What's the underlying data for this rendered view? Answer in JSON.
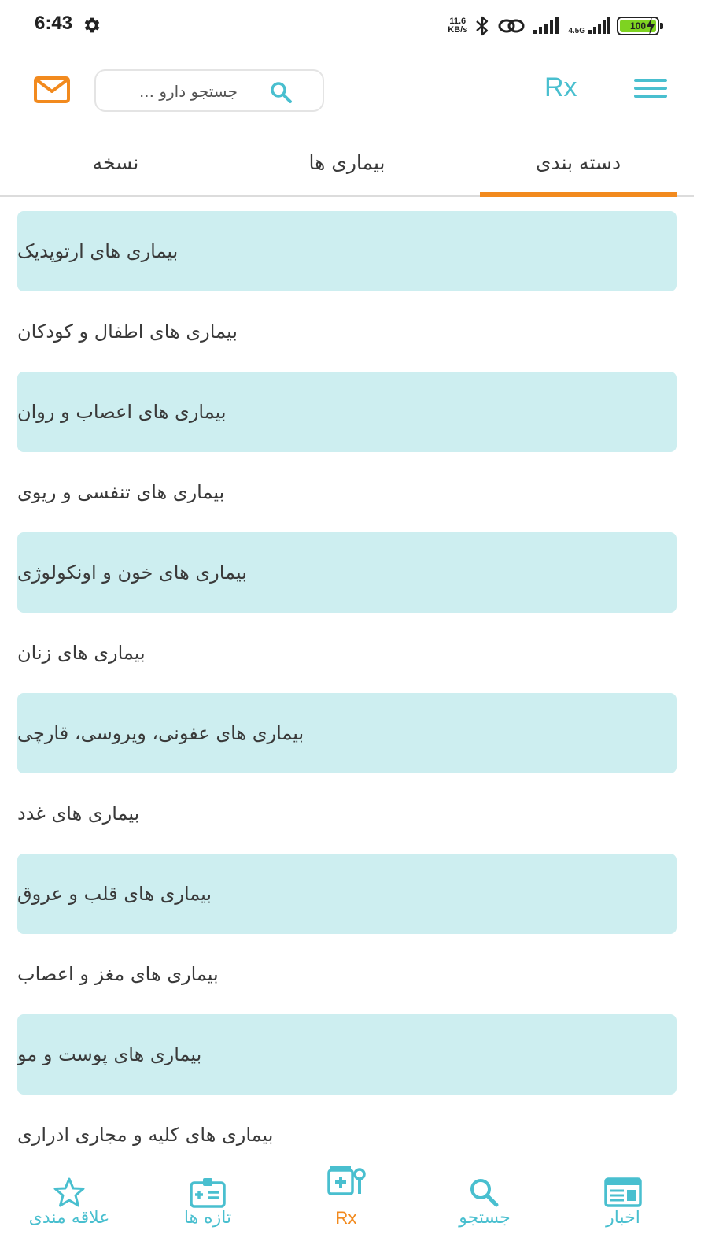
{
  "status_bar": {
    "time": "6:43",
    "net_speed_value": "11.6",
    "net_speed_unit": "KB/s",
    "network_type": "4.5G",
    "battery": "100"
  },
  "header": {
    "logo": "Rx",
    "search": {
      "placeholder": "جستجو دارو ...",
      "value": ""
    }
  },
  "tabs": [
    {
      "label": "نسخه"
    },
    {
      "label": "بیماری ها"
    },
    {
      "label": "دسته بندی"
    }
  ],
  "active_tab": "دسته بندی",
  "categories": [
    {
      "label": "بیماری های ارتوپدیک"
    },
    {
      "label": "بیماری های اطفال و کودکان"
    },
    {
      "label": "بیماری های اعصاب و روان"
    },
    {
      "label": "بیماری های تنفسی و ریوی"
    },
    {
      "label": "بیماری های خون و اونکولوژی"
    },
    {
      "label": "بیماری های زنان"
    },
    {
      "label": "بیماری های عفونی، ویروسی، قارچی"
    },
    {
      "label": "بیماری های غدد"
    },
    {
      "label": "بیماری های قلب و عروق"
    },
    {
      "label": "بیماری های مغز و اعصاب"
    },
    {
      "label": "بیماری های پوست و مو"
    },
    {
      "label": "بیماری های کلیه و مجاری ادراری"
    }
  ],
  "bottom_nav": [
    {
      "label": "علاقه مندی",
      "icon": "star-icon"
    },
    {
      "label": "تازه ها",
      "icon": "id-card-icon"
    },
    {
      "label": "Rx",
      "icon": "medicine-icon"
    },
    {
      "label": "جستجو",
      "icon": "search-icon"
    },
    {
      "label": "اخبار",
      "icon": "newspaper-icon"
    }
  ],
  "colors": {
    "accent": "#49bfcf",
    "highlight": "#f28a1e",
    "row_shade": "#cdeef0"
  }
}
